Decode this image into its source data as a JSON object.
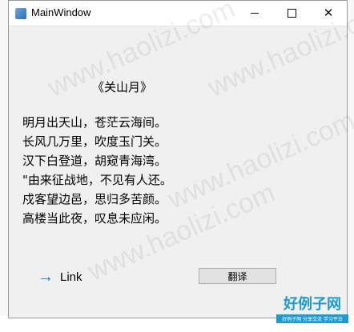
{
  "window": {
    "title": "MainWindow"
  },
  "poem": {
    "title": "《关山月》",
    "lines": [
      "明月出天山，苍茫云海间。",
      "长风几万里，吹度玉门关。",
      "汉下白登道，胡窥青海湾。",
      "\"由来征战地，不见有人还。",
      "戍客望边邑，思归多苦颜。",
      "高楼当此夜，叹息未应闲。"
    ]
  },
  "link": {
    "label": "Link",
    "icon": "arrow-right-icon",
    "color": "#1a73d9"
  },
  "translate_button": {
    "label": "翻译"
  },
  "watermark": {
    "text": "www.haolizi.com"
  },
  "brand": {
    "name": "好例子网",
    "tagline": "好例子网 分享交流 学习平台",
    "color": "#1d9bd1"
  }
}
